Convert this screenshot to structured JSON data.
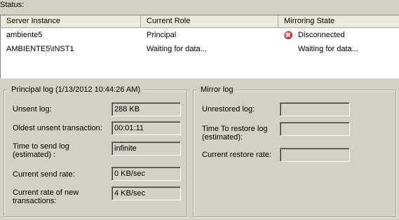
{
  "status": {
    "label": "Status:",
    "columns": [
      "Server Instance",
      "Current Role",
      "Mirroring State"
    ],
    "rows": [
      {
        "server_instance": "ambiente5",
        "current_role": "Principal",
        "mirroring_state": "Disconnected",
        "state_icon": "error-icon"
      },
      {
        "server_instance": "AMBIENTE5\\INST1",
        "current_role": "Waiting for data...",
        "mirroring_state": "Waiting for data..."
      }
    ]
  },
  "principal_log": {
    "title": "Principal log (1/13/2012 10:44:26 AM)",
    "unsent_log_label": "Unsent log:",
    "unsent_log_value": "288 KB",
    "oldest_unsent_label": "Oldest unsent transaction:",
    "oldest_unsent_value": "00:01:11",
    "time_to_send_label": "Time to send log (estimated) :",
    "time_to_send_value": "infinite",
    "send_rate_label": "Current send rate:",
    "send_rate_value": "0 KB/sec",
    "new_tx_rate_label": "Current rate of new transactions:",
    "new_tx_rate_value": "4 KB/sec"
  },
  "mirror_log": {
    "title": "Mirror log",
    "unrestored_label": "Unrestored log:",
    "unrestored_value": "",
    "time_to_restore_label": "Time To restore log (estimated):",
    "time_to_restore_value": "",
    "restore_rate_label": "Current restore rate:",
    "restore_rate_value": ""
  }
}
